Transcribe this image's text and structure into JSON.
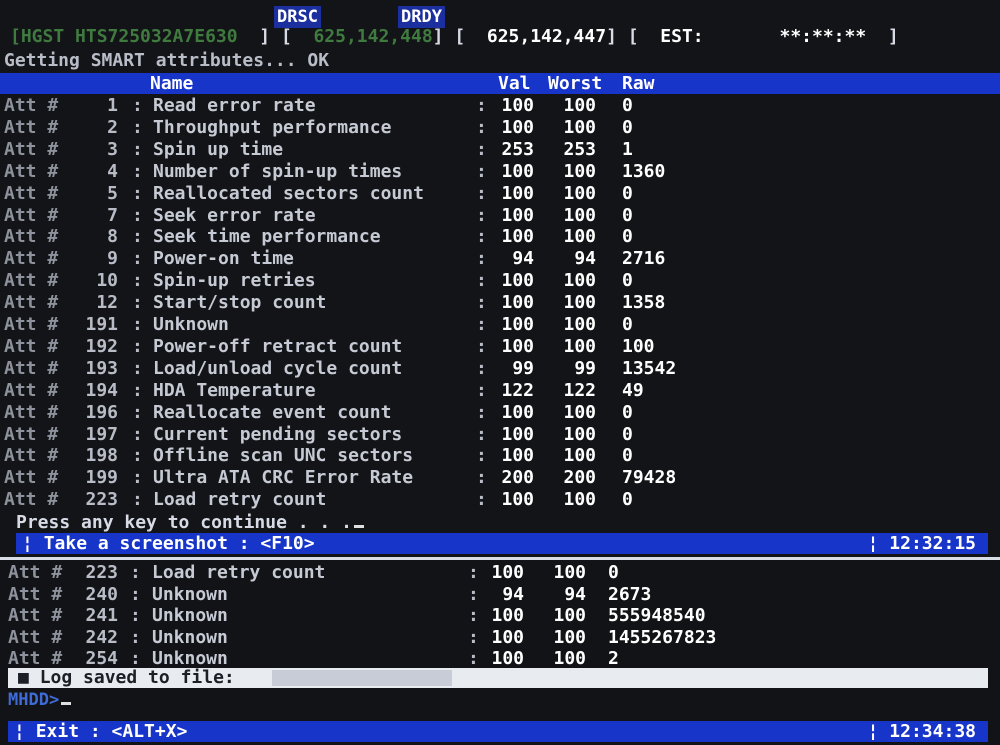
{
  "status_flags": [
    "DRSC",
    "DRDY"
  ],
  "drive": {
    "model": "HGST HTS725032A7E630",
    "lba_a": "625,142,448",
    "lba_b": "625,142,447",
    "est_label": "EST:",
    "est_value": "**:**:**"
  },
  "status_message": "Getting SMART attributes... OK",
  "table_header": {
    "name": "Name",
    "val": "Val",
    "worst": "Worst",
    "raw": "Raw"
  },
  "attr_prefix": "Att #",
  "top_rows": [
    {
      "id": "1",
      "name": "Read error rate",
      "val": "100",
      "worst": "100",
      "raw": "0"
    },
    {
      "id": "2",
      "name": "Throughput performance",
      "val": "100",
      "worst": "100",
      "raw": "0"
    },
    {
      "id": "3",
      "name": "Spin up time",
      "val": "253",
      "worst": "253",
      "raw": "1"
    },
    {
      "id": "4",
      "name": "Number of spin-up times",
      "val": "100",
      "worst": "100",
      "raw": "1360"
    },
    {
      "id": "5",
      "name": "Reallocated sectors count",
      "val": "100",
      "worst": "100",
      "raw": "0"
    },
    {
      "id": "7",
      "name": "Seek error rate",
      "val": "100",
      "worst": "100",
      "raw": "0"
    },
    {
      "id": "8",
      "name": "Seek time performance",
      "val": "100",
      "worst": "100",
      "raw": "0"
    },
    {
      "id": "9",
      "name": "Power-on time",
      "val": "94",
      "worst": "94",
      "raw": "2716"
    },
    {
      "id": "10",
      "name": "Spin-up retries",
      "val": "100",
      "worst": "100",
      "raw": "0"
    },
    {
      "id": "12",
      "name": "Start/stop count",
      "val": "100",
      "worst": "100",
      "raw": "1358"
    },
    {
      "id": "191",
      "name": "Unknown",
      "val": "100",
      "worst": "100",
      "raw": "0"
    },
    {
      "id": "192",
      "name": "Power-off retract count",
      "val": "100",
      "worst": "100",
      "raw": "100"
    },
    {
      "id": "193",
      "name": "Load/unload cycle count",
      "val": "99",
      "worst": "99",
      "raw": "13542"
    },
    {
      "id": "194",
      "name": "HDA Temperature",
      "val": "122",
      "worst": "122",
      "raw": "49"
    },
    {
      "id": "196",
      "name": "Reallocate event count",
      "val": "100",
      "worst": "100",
      "raw": "0"
    },
    {
      "id": "197",
      "name": "Current pending sectors",
      "val": "100",
      "worst": "100",
      "raw": "0"
    },
    {
      "id": "198",
      "name": "Offline scan UNC sectors",
      "val": "100",
      "worst": "100",
      "raw": "0"
    },
    {
      "id": "199",
      "name": "Ultra ATA CRC Error Rate",
      "val": "200",
      "worst": "200",
      "raw": "79428"
    },
    {
      "id": "223",
      "name": "Load retry count",
      "val": "100",
      "worst": "100",
      "raw": "0"
    }
  ],
  "continue_prompt": "Press any key to continue . . .",
  "top_bar": {
    "hint": "Take a screenshot : <F10>",
    "time": "12:32:15"
  },
  "bottom_rows": [
    {
      "id": "223",
      "name": "Load retry count",
      "val": "100",
      "worst": "100",
      "raw": "0"
    },
    {
      "id": "240",
      "name": "Unknown",
      "val": "94",
      "worst": "94",
      "raw": "2673"
    },
    {
      "id": "241",
      "name": "Unknown",
      "val": "100",
      "worst": "100",
      "raw": "555948540"
    },
    {
      "id": "242",
      "name": "Unknown",
      "val": "100",
      "worst": "100",
      "raw": "1455267823"
    },
    {
      "id": "254",
      "name": "Unknown",
      "val": "100",
      "worst": "100",
      "raw": "2"
    }
  ],
  "log_message": "Log saved to file:",
  "cli_prompt": "MHDD>",
  "bottom_bar": {
    "hint": "Exit : <ALT+X>",
    "time": "12:34:38"
  },
  "colors": {
    "accent_blue": "#1835c9",
    "prompt_blue": "#3f6bd6",
    "background": "#131417"
  }
}
